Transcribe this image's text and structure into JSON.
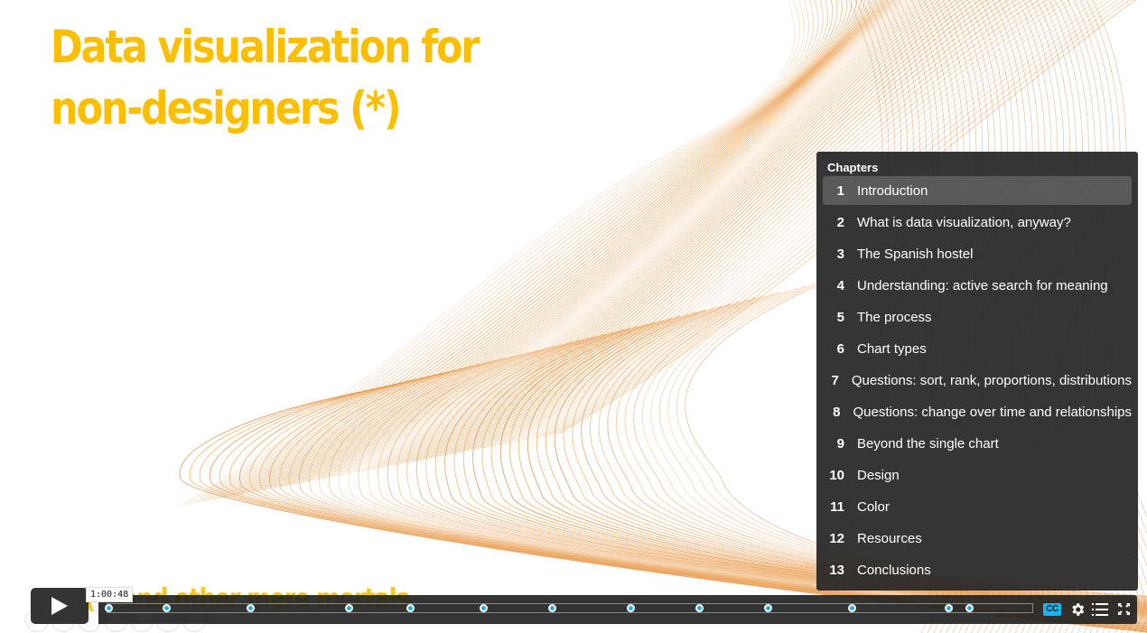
{
  "slide": {
    "title_line1": "Data visualization for",
    "title_line2": "non-designers (*)",
    "subtitle": "(*) and other mere mortals"
  },
  "colors": {
    "title": "#fbbf00",
    "accent": "#19b4ef",
    "panel_bg": "#262626",
    "wave": "#e8943a"
  },
  "chapters": {
    "heading": "Chapters",
    "active_index": 1,
    "items": [
      {
        "num": "1",
        "label": "Introduction"
      },
      {
        "num": "2",
        "label": "What is data visualization, anyway?"
      },
      {
        "num": "3",
        "label": "The Spanish hostel"
      },
      {
        "num": "4",
        "label": "Understanding: active search for meaning"
      },
      {
        "num": "5",
        "label": "The process"
      },
      {
        "num": "6",
        "label": "Chart types"
      },
      {
        "num": "7",
        "label": "Questions: sort, rank, proportions, distributions"
      },
      {
        "num": "8",
        "label": "Questions: change over time and relationships"
      },
      {
        "num": "9",
        "label": "Beyond the single chart"
      },
      {
        "num": "10",
        "label": "Design"
      },
      {
        "num": "11",
        "label": "Color"
      },
      {
        "num": "12",
        "label": "Resources"
      },
      {
        "num": "13",
        "label": "Conclusions"
      }
    ]
  },
  "player": {
    "hover_time": "1:00:48",
    "state": "paused",
    "chapter_marker_fractions": [
      0.0,
      0.065,
      0.159,
      0.269,
      0.338,
      0.42,
      0.496,
      0.584,
      0.661,
      0.738,
      0.832,
      0.94,
      0.964
    ],
    "icons": {
      "play": "play-icon",
      "captions": "CC",
      "settings": "gear-icon",
      "chapters": "list-icon",
      "fullscreen": "fullscreen-icon"
    }
  }
}
